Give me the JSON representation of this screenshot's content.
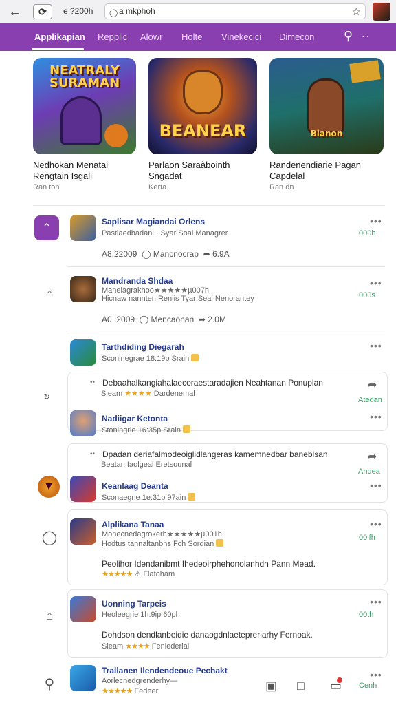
{
  "browser": {
    "tab_text": "e ?200h",
    "url": "a mkphoh",
    "colors": {
      "bar": "#f1f1f3"
    }
  },
  "nav": {
    "tabs": [
      "Applikapian",
      "Repplic",
      "Alowr",
      "Holte",
      "Vinekecici",
      "Dimecon"
    ],
    "active_index": 0,
    "accent": "#8a3fb0"
  },
  "featured": [
    {
      "art": "NEATRALY SURAMAN",
      "title": "Nedhokan Menatai Rengtain Isgali",
      "sub": "Ran ton"
    },
    {
      "art": "BEANEAR",
      "title": "Parlaon Saraàbointh Sngadat",
      "sub": "Kerta"
    },
    {
      "art": "Bianon",
      "title": "Randenendiarie Pagan Capdelal",
      "sub": "Ran dn"
    }
  ],
  "apps": [
    {
      "name": "Saplisar Magiandai Orlens",
      "meta": "Pastlaedbadani · Syar Soal Managrer",
      "stats": "A8.22009",
      "comments": "Mancnocrap",
      "shares": "6.9A",
      "download": "000h"
    },
    {
      "name": "Mandranda Shdaa",
      "meta_top": "Manelagrakhoo★★★★★µ007h",
      "meta": "Hicnaw nannten Reniis Tyar Seal Nenorantey",
      "stats": "A0 :2009",
      "comments": "Mencaonan",
      "shares": "2.0M",
      "download": "000s"
    },
    {
      "name": "Tarthdiding Diegarah",
      "meta": "Sconinegrae 18:19p Srain",
      "download": ""
    },
    {
      "name": "Nadiigar Ketonta",
      "meta": "Stoningrie 16:35p Srain"
    },
    {
      "name": "Keanlaag Deanta",
      "meta": "Sconaegrie 1e:31p 97ain"
    },
    {
      "name": "Alplikana Tanaa",
      "meta_top": "Monecnedagrokerh★★★★★µ001h",
      "meta": "Hodtus tannaltanbns Fch Sordian",
      "desc": "Peolihor Idendanibmt Ihedeoirphehonolanhdn Pann Mead.",
      "desc_meta": "Flatoham",
      "download": "00ifh"
    },
    {
      "name": "Uonning Tarpeis",
      "meta": "Heoleegrie 1h:9ip 60ph",
      "desc": "Dohdson dendlanbeidie danaogdnlaetepreriarhy Fernoak.",
      "desc_meta": "Fenlederial",
      "desc_prefix": "Sieam",
      "download": "00th"
    },
    {
      "name": "Trallanen Ilendendeoue Pechakt",
      "meta": "Aorlecnedgrenderhy—",
      "meta2": "Fedeer",
      "download": "Cenh"
    }
  ],
  "reviews": [
    {
      "text": "Debaahalkangiahalaecoraestaradajien Neahtanan Ponuplan",
      "prefix": "Sieam",
      "meta": "Dardenemal",
      "label": "Atedan"
    },
    {
      "text": "Dpadan deriafalmodeoiglidlangeras kamemnedbar baneblsan",
      "prefix": "",
      "meta": "Beatan Iaolgeal Eretsounal",
      "label": "Andea"
    }
  ],
  "desc_items": [
    {
      "text": "Peolihor Idendanibmt Ihedeoirphehonolanhdn Pann Mead.",
      "meta": "Flatoham"
    },
    {
      "text": "Dohdson dendlanbeidie danaogdnlaetepreriarhy Fernoak.",
      "meta": "Fenlederial",
      "prefix": "Sieam"
    }
  ],
  "bottom": {
    "label": "Cenh"
  }
}
